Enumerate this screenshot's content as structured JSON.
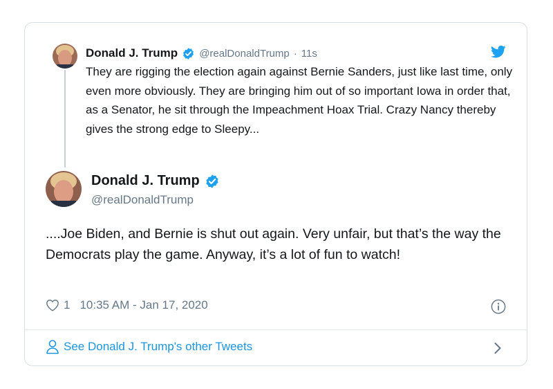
{
  "parent_tweet": {
    "author_name": "Donald J. Trump",
    "handle": "@realDonaldTrump",
    "separator": "·",
    "time_ago": "11s",
    "text": "They are rigging the election again against Bernie Sanders, just like last time, only even more obviously. They are bringing him out of so important Iowa in order that, as a Senator, he sit through the Impeachment Hoax Trial. Crazy Nancy thereby gives the strong edge to Sleepy..."
  },
  "main_tweet": {
    "author_name": "Donald J. Trump",
    "handle": "@realDonaldTrump",
    "text": "....Joe Biden, and Bernie is shut out again. Very unfair, but that’s the way the Democrats play the game. Anyway, it’s a lot of fun to watch!",
    "like_count": "1",
    "timestamp": "10:35 AM - Jan 17, 2020"
  },
  "footer": {
    "link_text": "See Donald J. Trump's other Tweets"
  },
  "colors": {
    "accent": "#1da1f2",
    "link": "#1b95e0",
    "muted": "#657786",
    "text": "#14171a",
    "border": "#d9dee3"
  },
  "icons": {
    "verified": "verified-badge-icon",
    "brand": "twitter-bird-icon",
    "like": "heart-icon",
    "info": "info-icon",
    "profile": "person-icon",
    "next": "chevron-right-icon"
  }
}
